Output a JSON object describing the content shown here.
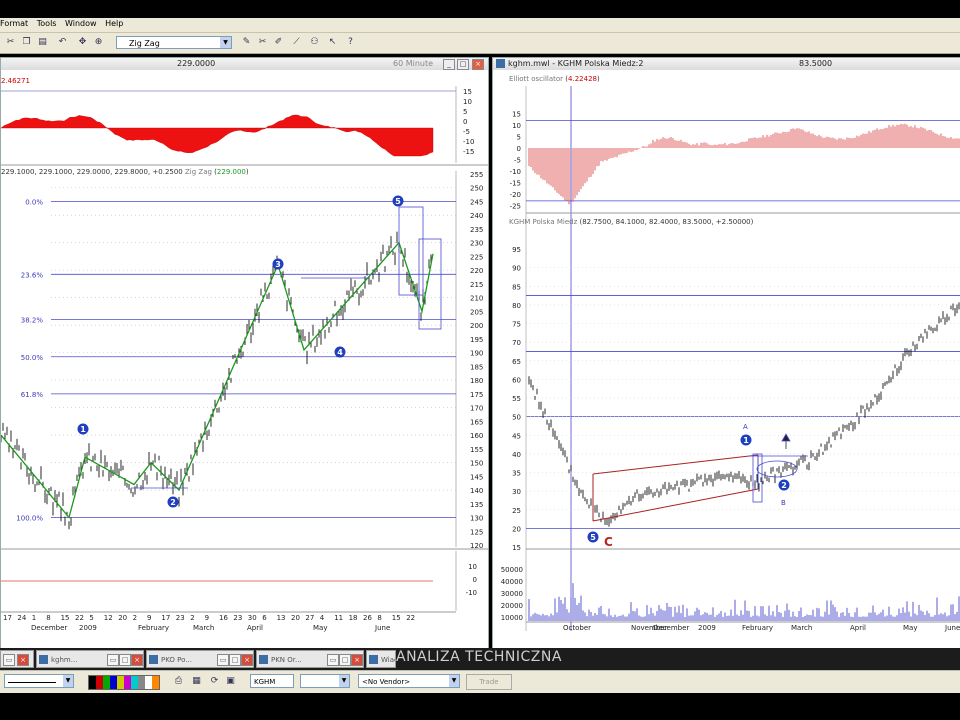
{
  "menu": {
    "items": [
      "Format",
      "Tools",
      "Window",
      "Help"
    ]
  },
  "toolbar": {
    "study": "Zig Zag"
  },
  "left_window": {
    "price": "229.0000",
    "interval": "60 Minute",
    "osc_value": "2.46271",
    "osc_ticks": [
      "15",
      "10",
      "5",
      "0",
      "-5",
      "-10",
      "-15"
    ],
    "price_header": "229.1000, 229.1000, 229.0000, 229.8000, +0.2500",
    "zigzag_label": "Zig Zag",
    "zigzag_value": "229.000",
    "fib_levels": [
      "0.0%",
      "23.6%",
      "38.2%",
      "50.0%",
      "61.8%",
      "100.0%"
    ],
    "price_ticks": [
      "255",
      "250",
      "245",
      "240",
      "235",
      "230",
      "225",
      "220",
      "215",
      "210",
      "205",
      "200",
      "195",
      "190",
      "185",
      "180",
      "175",
      "170",
      "165",
      "160",
      "155",
      "150",
      "145",
      "140",
      "135",
      "130",
      "125",
      "120"
    ],
    "wave_labels": [
      "1",
      "2",
      "3",
      "4",
      "5"
    ],
    "vol_ticks": [
      "10",
      "0",
      "-10"
    ],
    "dates_row1": [
      "17",
      "24",
      "1",
      "8",
      "15",
      "22",
      "5",
      "12",
      "20",
      "2",
      "9",
      "17",
      "23",
      "2",
      "9",
      "16",
      "23",
      "30",
      "6",
      "13",
      "20",
      "27",
      "4",
      "11",
      "18",
      "26",
      "8",
      "15",
      "22"
    ],
    "dates_row2": [
      "December",
      "2009",
      "February",
      "March",
      "April",
      "May",
      "June"
    ]
  },
  "right_window": {
    "title": "kghm.mwl - KGHM Polska Miedz:2",
    "price": "83.5000",
    "osc_label": "Elliott oscillator",
    "osc_value": "4.22428",
    "osc_ticks": [
      "15",
      "10",
      "5",
      "0",
      "-5",
      "-10",
      "-15",
      "-20",
      "-25"
    ],
    "price_header_name": "KGHM Polska Miedz",
    "price_header": "82.7500, 84.1000, 82.4000, 83.5000, +2.50000",
    "price_ticks": [
      "95",
      "90",
      "85",
      "80",
      "75",
      "70",
      "65",
      "60",
      "55",
      "50",
      "45",
      "40",
      "35",
      "30",
      "25",
      "20",
      "15"
    ],
    "vol_ticks": [
      "50000",
      "40000",
      "30000",
      "20000",
      "10000"
    ],
    "dates": [
      "October",
      "November",
      "December",
      "2009",
      "February",
      "March",
      "April",
      "May",
      "June"
    ],
    "annotations": {
      "wave5": "5",
      "c_label": "C",
      "wave1": "1",
      "wave2": "2",
      "a_label": "A",
      "b_label": "B"
    }
  },
  "taskbar": {
    "tasks": [
      "kghm...",
      "PKO Po...",
      "PKN Or...",
      "Wiadx..."
    ],
    "watermark": "ANALIZA TECHNICZNA"
  },
  "bottombar": {
    "symbol": "KGHM",
    "vendor": "<No Vendor>",
    "trade_label": "Trade"
  },
  "chart_data": [
    {
      "type": "line",
      "title": "",
      "series": [
        {
          "name": "Zig Zag",
          "values": [
            160,
            130,
            152,
            142,
            150,
            140,
            222,
            191,
            230,
            205,
            226
          ]
        }
      ],
      "fib_retracements": {
        "0.0%": 245,
        "23.6%": 218.5,
        "38.2%": 202,
        "50.0%": 188.5,
        "61.8%": 175,
        "100.0%": 130
      },
      "ylim": [
        120,
        255
      ]
    },
    {
      "type": "line",
      "series": [
        {
          "name": "KGHM Polska Miedz",
          "values": [
            60,
            45,
            30,
            22,
            28,
            30,
            31,
            33,
            34,
            32,
            36,
            38,
            44,
            50,
            58,
            68,
            75,
            80
          ]
        }
      ],
      "ylim": [
        15,
        95
      ]
    }
  ]
}
